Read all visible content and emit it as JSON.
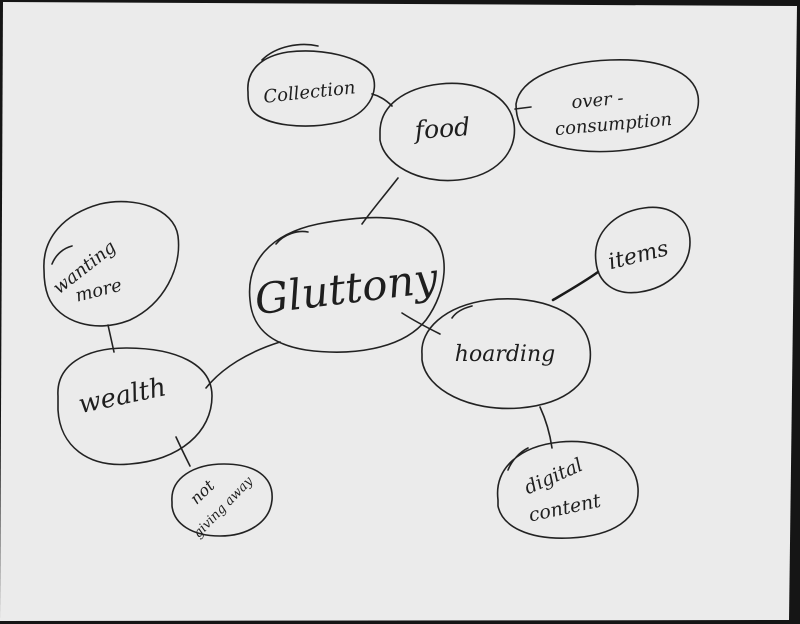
{
  "nodes": {
    "center": "Gluttony",
    "food": "food",
    "collection": "Collection",
    "overconsumption_line1": "over -",
    "overconsumption_line2": "consumption",
    "hoarding": "hoarding",
    "items": "items",
    "digital_line1": "digital",
    "digital_line2": "content",
    "wealth": "wealth",
    "wanting_line1": "wanting",
    "wanting_line2": "more",
    "notgiving_line1": "not",
    "notgiving_line2": "giving away"
  },
  "colors": {
    "paper": "#ebebeb",
    "ink": "#222222",
    "background": "#151515"
  }
}
